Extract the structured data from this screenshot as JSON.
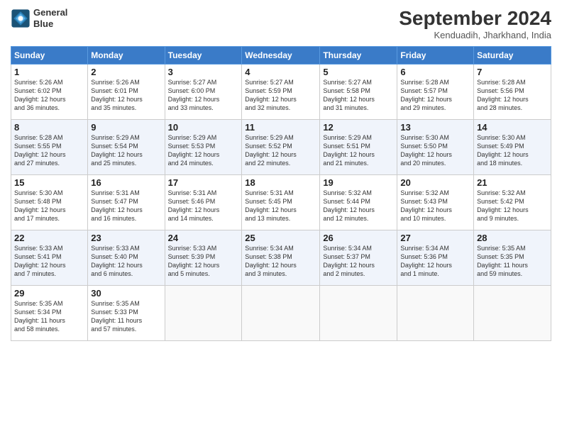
{
  "header": {
    "logo_text_line1": "General",
    "logo_text_line2": "Blue",
    "month_title": "September 2024",
    "location": "Kenduadih, Jharkhand, India"
  },
  "weekdays": [
    "Sunday",
    "Monday",
    "Tuesday",
    "Wednesday",
    "Thursday",
    "Friday",
    "Saturday"
  ],
  "weeks": [
    [
      {
        "day": "1",
        "info": "Sunrise: 5:26 AM\nSunset: 6:02 PM\nDaylight: 12 hours\nand 36 minutes."
      },
      {
        "day": "2",
        "info": "Sunrise: 5:26 AM\nSunset: 6:01 PM\nDaylight: 12 hours\nand 35 minutes."
      },
      {
        "day": "3",
        "info": "Sunrise: 5:27 AM\nSunset: 6:00 PM\nDaylight: 12 hours\nand 33 minutes."
      },
      {
        "day": "4",
        "info": "Sunrise: 5:27 AM\nSunset: 5:59 PM\nDaylight: 12 hours\nand 32 minutes."
      },
      {
        "day": "5",
        "info": "Sunrise: 5:27 AM\nSunset: 5:58 PM\nDaylight: 12 hours\nand 31 minutes."
      },
      {
        "day": "6",
        "info": "Sunrise: 5:28 AM\nSunset: 5:57 PM\nDaylight: 12 hours\nand 29 minutes."
      },
      {
        "day": "7",
        "info": "Sunrise: 5:28 AM\nSunset: 5:56 PM\nDaylight: 12 hours\nand 28 minutes."
      }
    ],
    [
      {
        "day": "8",
        "info": "Sunrise: 5:28 AM\nSunset: 5:55 PM\nDaylight: 12 hours\nand 27 minutes."
      },
      {
        "day": "9",
        "info": "Sunrise: 5:29 AM\nSunset: 5:54 PM\nDaylight: 12 hours\nand 25 minutes."
      },
      {
        "day": "10",
        "info": "Sunrise: 5:29 AM\nSunset: 5:53 PM\nDaylight: 12 hours\nand 24 minutes."
      },
      {
        "day": "11",
        "info": "Sunrise: 5:29 AM\nSunset: 5:52 PM\nDaylight: 12 hours\nand 22 minutes."
      },
      {
        "day": "12",
        "info": "Sunrise: 5:29 AM\nSunset: 5:51 PM\nDaylight: 12 hours\nand 21 minutes."
      },
      {
        "day": "13",
        "info": "Sunrise: 5:30 AM\nSunset: 5:50 PM\nDaylight: 12 hours\nand 20 minutes."
      },
      {
        "day": "14",
        "info": "Sunrise: 5:30 AM\nSunset: 5:49 PM\nDaylight: 12 hours\nand 18 minutes."
      }
    ],
    [
      {
        "day": "15",
        "info": "Sunrise: 5:30 AM\nSunset: 5:48 PM\nDaylight: 12 hours\nand 17 minutes."
      },
      {
        "day": "16",
        "info": "Sunrise: 5:31 AM\nSunset: 5:47 PM\nDaylight: 12 hours\nand 16 minutes."
      },
      {
        "day": "17",
        "info": "Sunrise: 5:31 AM\nSunset: 5:46 PM\nDaylight: 12 hours\nand 14 minutes."
      },
      {
        "day": "18",
        "info": "Sunrise: 5:31 AM\nSunset: 5:45 PM\nDaylight: 12 hours\nand 13 minutes."
      },
      {
        "day": "19",
        "info": "Sunrise: 5:32 AM\nSunset: 5:44 PM\nDaylight: 12 hours\nand 12 minutes."
      },
      {
        "day": "20",
        "info": "Sunrise: 5:32 AM\nSunset: 5:43 PM\nDaylight: 12 hours\nand 10 minutes."
      },
      {
        "day": "21",
        "info": "Sunrise: 5:32 AM\nSunset: 5:42 PM\nDaylight: 12 hours\nand 9 minutes."
      }
    ],
    [
      {
        "day": "22",
        "info": "Sunrise: 5:33 AM\nSunset: 5:41 PM\nDaylight: 12 hours\nand 7 minutes."
      },
      {
        "day": "23",
        "info": "Sunrise: 5:33 AM\nSunset: 5:40 PM\nDaylight: 12 hours\nand 6 minutes."
      },
      {
        "day": "24",
        "info": "Sunrise: 5:33 AM\nSunset: 5:39 PM\nDaylight: 12 hours\nand 5 minutes."
      },
      {
        "day": "25",
        "info": "Sunrise: 5:34 AM\nSunset: 5:38 PM\nDaylight: 12 hours\nand 3 minutes."
      },
      {
        "day": "26",
        "info": "Sunrise: 5:34 AM\nSunset: 5:37 PM\nDaylight: 12 hours\nand 2 minutes."
      },
      {
        "day": "27",
        "info": "Sunrise: 5:34 AM\nSunset: 5:36 PM\nDaylight: 12 hours\nand 1 minute."
      },
      {
        "day": "28",
        "info": "Sunrise: 5:35 AM\nSunset: 5:35 PM\nDaylight: 11 hours\nand 59 minutes."
      }
    ],
    [
      {
        "day": "29",
        "info": "Sunrise: 5:35 AM\nSunset: 5:34 PM\nDaylight: 11 hours\nand 58 minutes."
      },
      {
        "day": "30",
        "info": "Sunrise: 5:35 AM\nSunset: 5:33 PM\nDaylight: 11 hours\nand 57 minutes."
      },
      {
        "day": "",
        "info": ""
      },
      {
        "day": "",
        "info": ""
      },
      {
        "day": "",
        "info": ""
      },
      {
        "day": "",
        "info": ""
      },
      {
        "day": "",
        "info": ""
      }
    ]
  ]
}
